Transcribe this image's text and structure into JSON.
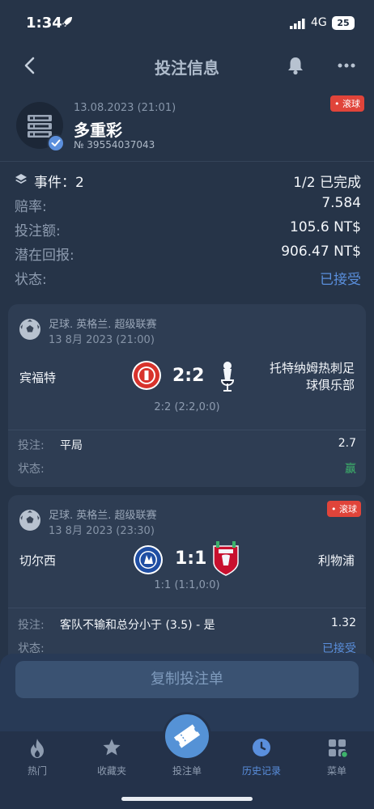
{
  "status_bar": {
    "time": "1:34",
    "network": "4G",
    "battery": "25"
  },
  "header": {
    "title": "投注信息"
  },
  "bet": {
    "datetime": "13.08.2023 (21:01)",
    "type": "多重彩",
    "number": "№ 39554037043",
    "live_badge": "• 滚球"
  },
  "summary_rows": {
    "events_label": "事件：2",
    "events_value": "1/2 已完成",
    "odds_label": "赔率:",
    "odds_value": "7.584",
    "stake_label": "投注额:",
    "stake_value": "105.6 NT$",
    "payout_label": "潜在回报:",
    "payout_value": "906.47 NT$",
    "status_label": "状态:",
    "status_value": "已接受"
  },
  "events": [
    {
      "league": "足球. 英格兰. 超级联赛",
      "date": "13 8月 2023 (21:00)",
      "home": "宾福特",
      "score": "2:2",
      "away_line1": "托特纳姆热刺足",
      "away_line2": "球俱乐部",
      "halftime": "2:2 (2:2,0:0)",
      "bet_label": "投注:",
      "selection": "平局",
      "odds": "2.7",
      "status_label": "状态:",
      "status": "赢",
      "home_color": "#d8332c",
      "away_color": "#1b2437"
    },
    {
      "league": "足球. 英格兰. 超级联赛",
      "date": "13 8月 2023 (23:30)",
      "live_badge": "• 滚球",
      "home": "切尔西",
      "score": "1:1",
      "away": "利物浦",
      "halftime": "1:1 (1:1,0:0)",
      "bet_label": "投注:",
      "selection": "客队不输和总分小于 (3.5) - 是",
      "odds": "1.32",
      "status_label": "状态:",
      "status": "已接受",
      "home_color": "#1f4ea3",
      "away_color": "#c8102e"
    }
  ],
  "copy_button": "复制投注单",
  "tabs": [
    {
      "label": "热门",
      "icon": "flame-icon"
    },
    {
      "label": "收藏夹",
      "icon": "star-icon"
    },
    {
      "label": "投注单",
      "icon": "ticket-icon"
    },
    {
      "label": "历史记录",
      "icon": "clock-icon"
    },
    {
      "label": "菜单",
      "icon": "menu-grid-icon"
    }
  ],
  "colors": {
    "background": "#263448",
    "accent": "#5a8fdd",
    "live": "#e0443a",
    "win": "#3db36b"
  }
}
